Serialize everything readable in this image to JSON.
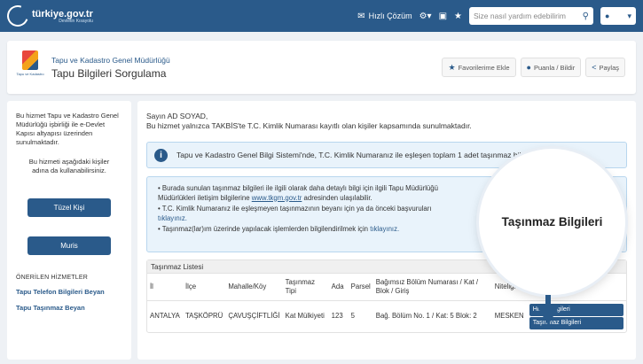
{
  "topbar": {
    "logo_text": "türkiye.gov.tr",
    "logo_sub": "Devletin Kısayolu",
    "hizli_cozum": "Hızlı Çözüm",
    "search_placeholder": "Size nasıl yardım edebilirim"
  },
  "header": {
    "logo_label": "Tapu ve Kadastro",
    "subtitle": "Tapu ve Kadastro Genel Müdürlüğü",
    "title": "Tapu Bilgileri Sorgulama",
    "actions": [
      "Favorilerime Ekle",
      "Puanla / Bildir",
      "Paylaş"
    ]
  },
  "sidebar": {
    "para1": "Bu hizmet Tapu ve Kadastro Genel Müdürlüğü işbirliği ile e-Devlet Kapısı altyapısı üzerinden sunulmaktadır.",
    "para2": "Bu hizmeti aşağıdaki kişiler adına da kullanabilirsiniz.",
    "btn1": "Tüzel Kişi",
    "btn2": "Muris",
    "section_head": "ÖNERİLEN HİZMETLER",
    "links": [
      "Tapu Telefon Bilgileri Beyan",
      "Tapu Taşınmaz Beyan"
    ]
  },
  "main": {
    "greeting": "Sayın AD SOYAD,",
    "intro": "Bu hizmet yalnızca TAKBİS'te T.C. Kimlik Numarası kayıtlı olan kişiler kapsamında sunulmaktadır.",
    "alert": "Tapu ve Kadastro Genel Bilgi Sistemi'nde, T.C. Kimlik Numaranız ile eşleşen toplam 1 adet taşınmaz bilgisi bulunmaktadır.",
    "info1_a": "• Burada sunulan taşınmaz bilgileri ile ilgili olarak daha detaylı bilgi için ilgili Tapu Müdürlüğü",
    "info1_b": "Müdürlükleri iletişim bilgilerine",
    "info1_link": "www.tkgm.gov.tr",
    "info1_c": "adresinden ulaşılabilir.",
    "info2_a": "• T.C. Kimlik Numaranız ile eşleşmeyen taşınmazının beyanı için ya da önceki başvuruları",
    "info2_link": "tıklayınız.",
    "info3_a": "• Taşınmaz(lar)ım üzerinde yapılacak işlemlerden bilgilendirilmek için",
    "info3_link": "tıklayınız."
  },
  "table": {
    "title": "Taşınmaz Listesi",
    "headers": [
      "İl",
      "İlçe",
      "Mahalle/Köy",
      "Taşınmaz Tipi",
      "Ada",
      "Parsel",
      "Bağımsız Bölüm Numarası / Kat / Blok / Giriş",
      "Niteliği",
      ""
    ],
    "row": [
      "ANTALYA",
      "TAŞKÖPRÜ",
      "ÇAVUŞÇİFTLİĞİ",
      "Kat Mülkiyeti",
      "123",
      "5",
      "Bağ. Bölüm No. 1 / Kat: 5 Blok: 2",
      "MESKEN"
    ],
    "row_buttons": [
      "Hisse Bilgileri",
      "Taşınmaz Bilgileri"
    ]
  },
  "callout": {
    "text": "Taşınmaz Bilgileri"
  }
}
